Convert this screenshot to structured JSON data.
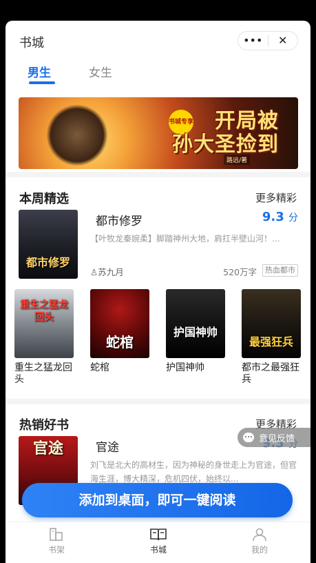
{
  "header": {
    "title": "书城",
    "more_icon": "more-dots-icon",
    "close_icon": "close-icon"
  },
  "tabs": [
    {
      "label": "男生",
      "active": true
    },
    {
      "label": "女生",
      "active": false
    }
  ],
  "banner": {
    "badge": "书城专享",
    "title_line1": "开局被",
    "title_line2": "孙大圣捡到",
    "author": "路远/著"
  },
  "weekly": {
    "title": "本周精选",
    "more": "更多精彩",
    "featured": {
      "title": "都市修罗",
      "score": "9.3",
      "score_unit": "分",
      "description": "【叶牧龙秦婉柔】脚踏神州大地，肩扛半壁山河！...",
      "author": "苏九月",
      "words": "520万字",
      "tag": "热血都市",
      "cover_text": "都市修罗"
    },
    "grid": [
      {
        "name": "重生之猛龙回头",
        "cover_text": "重生之猛龙回头"
      },
      {
        "name": "蛇棺",
        "cover_text": "蛇棺"
      },
      {
        "name": "护国神帅",
        "cover_text": "护国神帅"
      },
      {
        "name": "都市之最强狂兵",
        "cover_text": "最强狂兵"
      }
    ]
  },
  "bestseller": {
    "title": "热销好书",
    "more": "更多精彩",
    "featured": {
      "title": "官途",
      "score": "9.3",
      "score_unit": "分",
      "description": "刘飞是北大的高材生，因为神秘的身世走上为官途，但官海生涯，博大精深，危机四伏，始终以...",
      "cover_text": "官途"
    }
  },
  "feedback": {
    "label": "意见反馈"
  },
  "cta": {
    "label": "添加到桌面，即可一键阅读"
  },
  "tabbar": [
    {
      "label": "书架",
      "icon": "bookshelf-icon",
      "active": false
    },
    {
      "label": "书城",
      "icon": "book-open-icon",
      "active": true
    },
    {
      "label": "我的",
      "icon": "user-icon",
      "active": false
    }
  ],
  "colors": {
    "accent": "#1a6fe8",
    "cta": "#1f73ee"
  }
}
